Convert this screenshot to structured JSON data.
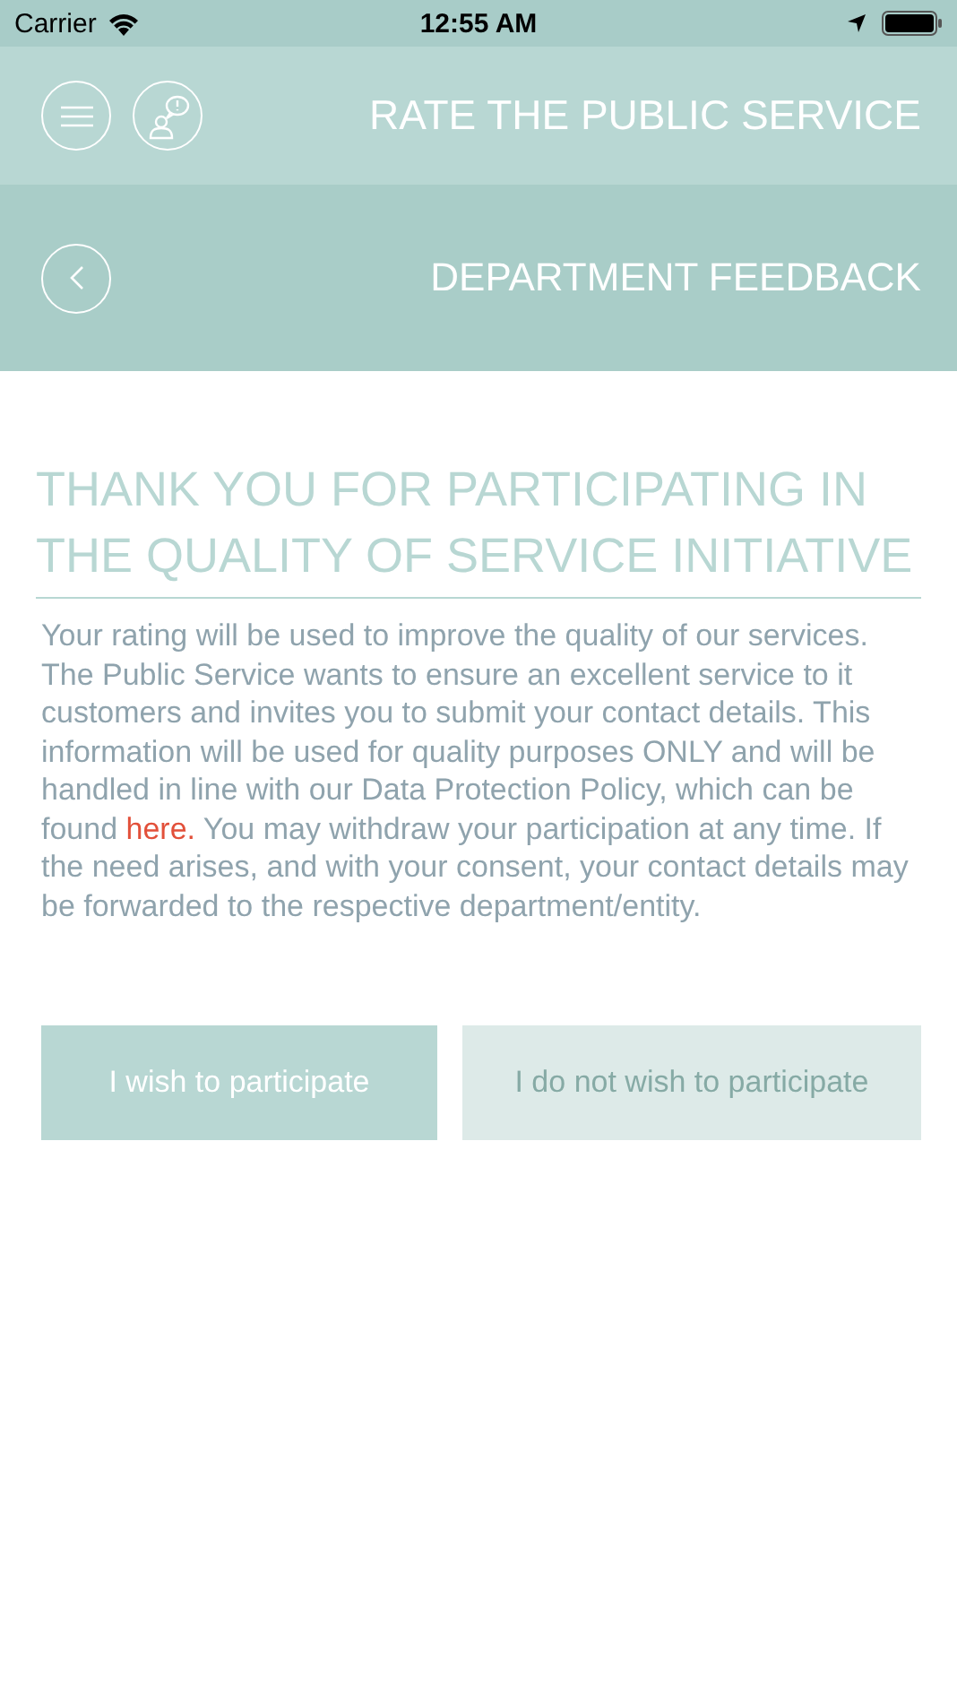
{
  "status_bar": {
    "carrier": "Carrier",
    "time": "12:55 AM"
  },
  "header": {
    "title": "RATE THE PUBLIC SERVICE"
  },
  "subheader": {
    "title": "DEPARTMENT FEEDBACK"
  },
  "heading": "THANK YOU FOR PARTICIPATING IN THE QUALITY OF SERVICE INITIATIVE",
  "body": {
    "before": "Your rating will be used to improve the quality of our services. The Public Service wants to ensure an excellent service to it customers and invites you to submit your contact details. This information will be used for quality purposes ONLY and will be handled in line with our Data Protection Policy, which can be found ",
    "link": "here.",
    "after": " You may withdraw your participation at any time. If the need arises, and with your consent, your contact details may be forwarded to the respective department/entity."
  },
  "buttons": [
    {
      "label": "I wish to participate",
      "kind": "primary"
    },
    {
      "label": "I do not wish to participate",
      "kind": "secondary"
    }
  ]
}
